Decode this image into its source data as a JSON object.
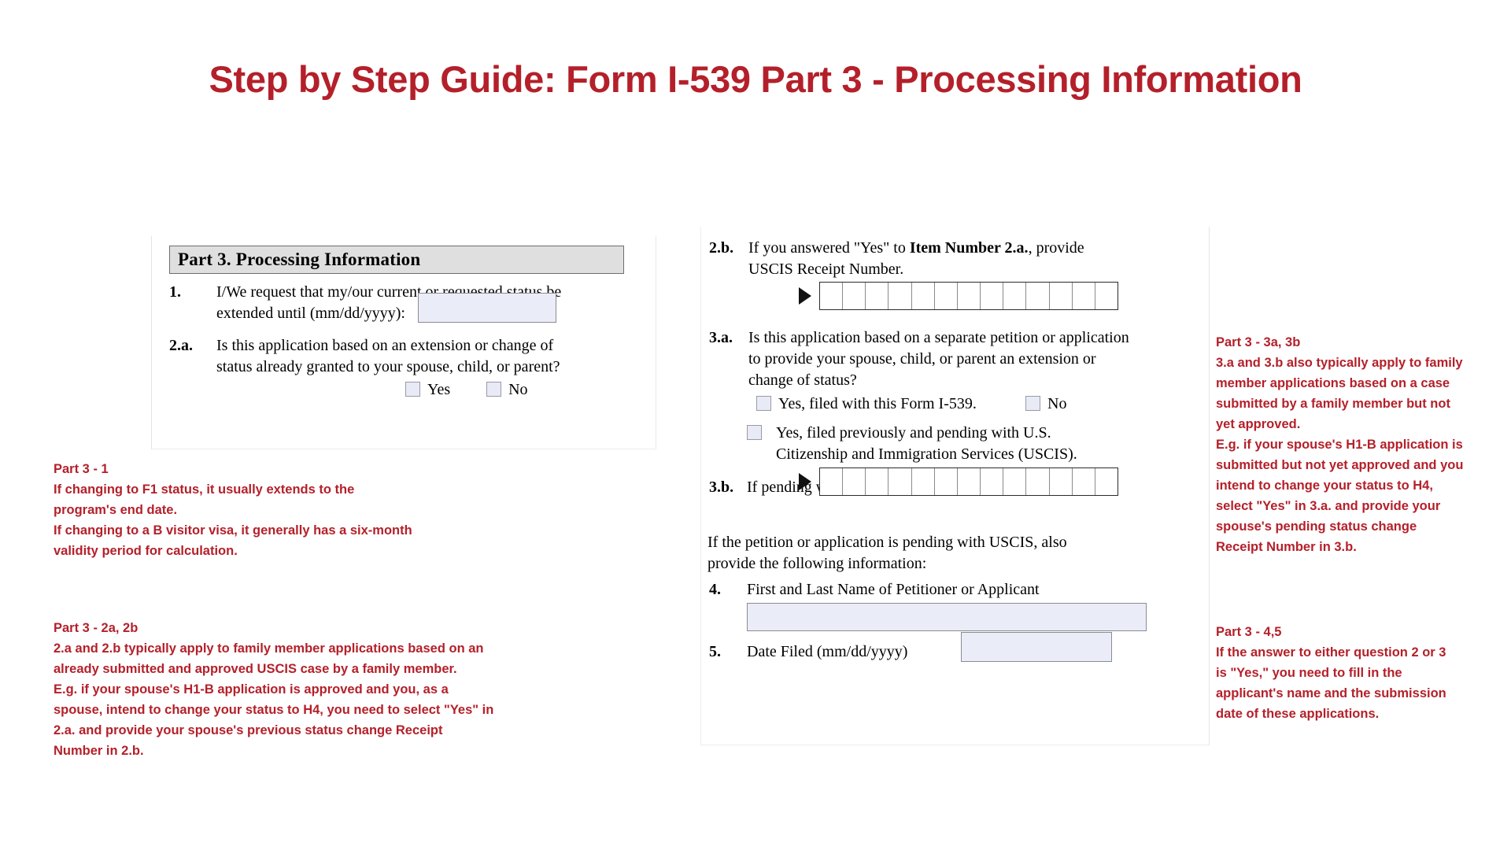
{
  "title": "Step by Step Guide: Form I-539 Part 3 - Processing Information",
  "colors": {
    "accent_red": "#B4202A",
    "field_fill": "#EAECF7",
    "header_fill": "#DFDFDF"
  },
  "form_left": {
    "part_header": "Part 3.  Processing Information",
    "item1": {
      "number": "1.",
      "line1": "I/We request that my/our current or requested status be",
      "line2": "extended until (mm/dd/yyyy):",
      "field_value": "",
      "field_placeholder": ""
    },
    "item2a": {
      "number": "2.a.",
      "line1": "Is this application based on an extension or change of",
      "line2": "status already granted to your spouse, child, or parent?",
      "options": [
        "Yes",
        "No"
      ]
    }
  },
  "form_center": {
    "item2b": {
      "number": "2.b.",
      "text_part1": "If you answered \"Yes\" to ",
      "text_bold": "Item Number 2.a.",
      "text_part2": ", provide",
      "line2": "USCIS Receipt Number.",
      "receipt_cells": 13,
      "receipt_value": ""
    },
    "item3a": {
      "number": "3.a.",
      "line1": "Is this application based on a separate petition or application",
      "line2": "to provide your spouse, child, or parent an extension or",
      "line3": "change of status?",
      "option_yes_filed": "Yes, filed with this Form I-539.",
      "option_no": "No",
      "option_pending_line1": "Yes, filed previously and pending with U.S.",
      "option_pending_line2": "Citizenship and Immigration Services (USCIS)."
    },
    "item3b": {
      "number": "3.b.",
      "text": "If pending with USCIS, provide USCIS Receipt Number.",
      "receipt_cells": 13,
      "receipt_value": ""
    },
    "note": {
      "line1": "If the petition or application is pending with USCIS, also",
      "line2": "provide the following information:"
    },
    "item4": {
      "number": "4.",
      "label": "First and Last Name of Petitioner or Applicant",
      "field_value": ""
    },
    "item5": {
      "number": "5.",
      "label": "Date Filed (mm/dd/yyyy)",
      "field_value": ""
    }
  },
  "annotations": {
    "part3_1": {
      "title": "Part 3 - 1",
      "lines": [
        "If changing to F1 status, it usually extends to the",
        "program's end date.",
        "If changing to a B visitor visa, it generally has a six-month",
        "validity period for calculation."
      ]
    },
    "part3_2a2b": {
      "title": "Part 3 - 2a, 2b",
      "lines": [
        "2.a and 2.b typically apply to family member applications based on an",
        "already submitted and approved USCIS case by a family member.",
        "E.g. if your spouse's H1-B application is approved and you, as a",
        "spouse, intend to change your status to H4, you need to select \"Yes\" in",
        "2.a. and provide your spouse's previous status change Receipt",
        "Number in 2.b."
      ]
    },
    "part3_3a3b": {
      "title": "Part 3 - 3a, 3b",
      "lines": [
        "3.a and 3.b also typically apply to family",
        "member applications based on a case",
        "submitted by a family member but not",
        "yet approved.",
        "E.g. if your spouse's H1-B application is",
        "submitted but not yet approved and you",
        "intend to change your status to H4,",
        "select \"Yes\" in 3.a. and provide your",
        "spouse's pending status change",
        "Receipt Number in 3.b."
      ]
    },
    "part3_45": {
      "title": "Part 3 - 4,5",
      "lines": [
        "If the answer to either question 2 or 3",
        "is \"Yes,\" you need to fill in the",
        "applicant's name and the submission",
        "date of these applications."
      ]
    }
  }
}
